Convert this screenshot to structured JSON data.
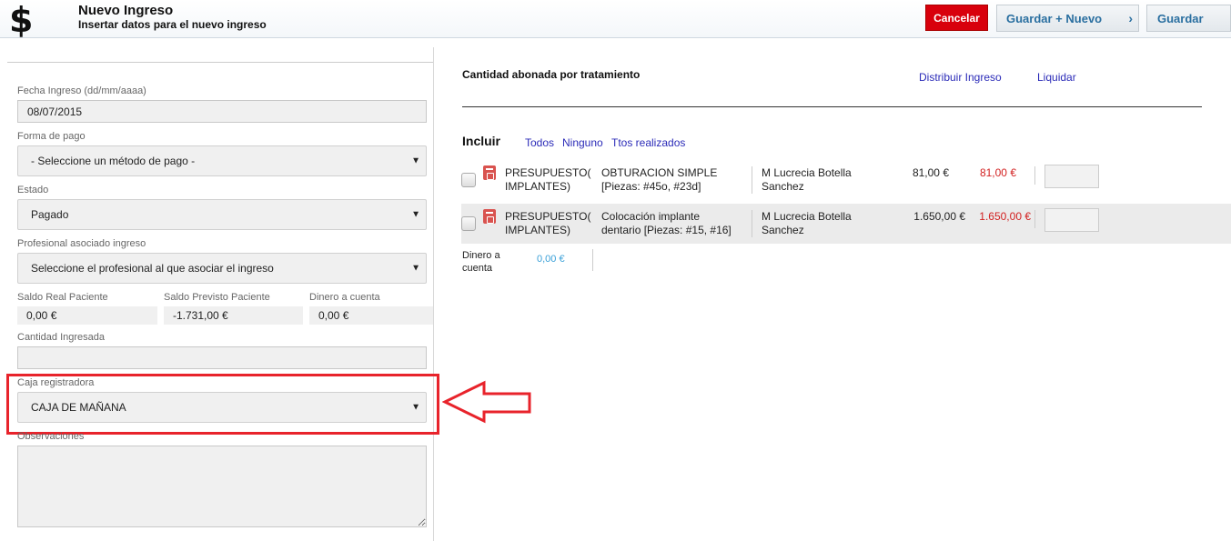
{
  "header": {
    "icon": "dollar-icon",
    "symbol": "$",
    "title": "Nuevo Ingreso",
    "subtitle": "Insertar datos para el nuevo ingreso",
    "cancel_label": "Cancelar",
    "save_new_label": "Guardar + Nuevo",
    "save_new_chevron": "›",
    "save_label": "Guardar",
    "cancel_color": "#d8000c",
    "accent_color": "#2a6fa0"
  },
  "form": {
    "fecha": {
      "label": "Fecha Ingreso (dd/mm/aaaa)",
      "value": "08/07/2015"
    },
    "forma_pago": {
      "label": "Forma de pago",
      "value": "- Seleccione un método de pago -"
    },
    "estado": {
      "label": "Estado",
      "value": "Pagado"
    },
    "profesional": {
      "label": "Profesional asociado ingreso",
      "value": "Seleccione el profesional al que asociar el ingreso"
    },
    "saldo_real": {
      "label": "Saldo Real Paciente",
      "value": "0,00 €"
    },
    "saldo_previsto": {
      "label": "Saldo Previsto Paciente",
      "value": "-1.731,00 €"
    },
    "dinero_cuenta": {
      "label": "Dinero a cuenta",
      "value": "0,00 €"
    },
    "cantidad": {
      "label": "Cantidad Ingresada",
      "value": ""
    },
    "caja": {
      "label": "Caja registradora",
      "value": "CAJA DE MAÑANA"
    },
    "observaciones": {
      "label": "Observaciones",
      "value": ""
    },
    "dropdown_arrow": "▼",
    "highlight_color": "#e8232b"
  },
  "tratamientos": {
    "title": "Cantidad abonada por tratamiento",
    "distribuir_label": "Distribuir Ingreso",
    "liquidar_label": "Liquidar",
    "incluir_label": "Incluir",
    "filter_todos": "Todos",
    "filter_ninguno": "Ninguno",
    "filter_realizados": "Ttos realizados",
    "link_color": "#2b2bb8",
    "rows": [
      {
        "tipo_line1": "PRESUPUESTO(",
        "tipo_line2": "IMPLANTES)",
        "tratamiento_line1": "OBTURACION SIMPLE",
        "tratamiento_line2": "[Piezas: #45o, #23d]",
        "profesional_line1": "M Lucrecia Botella",
        "profesional_line2": "Sanchez",
        "importe": "81,00 €",
        "pendiente": "81,00 €",
        "icon": "document-icon"
      },
      {
        "tipo_line1": "PRESUPUESTO(",
        "tipo_line2": "IMPLANTES)",
        "tratamiento_line1": "Colocación implante",
        "tratamiento_line2": "dentario [Piezas: #15, #16]",
        "profesional_line1": "M Lucrecia Botella",
        "profesional_line2": "Sanchez",
        "importe": "1.650,00 €",
        "pendiente": "1.650,00 €",
        "icon": "document-icon"
      }
    ],
    "dinero_cuenta_line1": "Dinero a",
    "dinero_cuenta_line2": "cuenta",
    "dinero_cuenta_value": "0,00 €",
    "dinero_color": "#3aa0d8"
  }
}
